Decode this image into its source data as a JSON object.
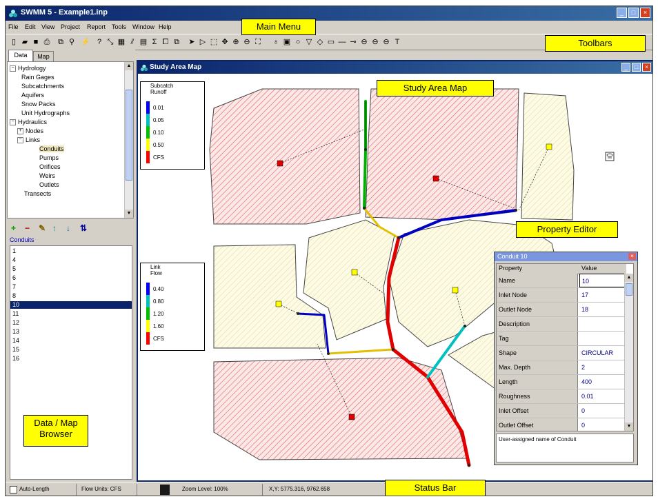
{
  "app": {
    "title": "SWMM 5 - Example1.inp",
    "controls": [
      "_",
      "□",
      "×"
    ]
  },
  "menu": [
    "File",
    "Edit",
    "View",
    "Project",
    "Report",
    "Tools",
    "Window",
    "Help"
  ],
  "callouts": {
    "main_menu": "Main Menu",
    "toolbars": "Toolbars",
    "study_area_map": "Study Area Map",
    "property_editor": "Property Editor",
    "browser_line1": "Data / Map",
    "browser_line2": "Browser",
    "status_bar": "Status Bar"
  },
  "browser": {
    "tabs": [
      "Data",
      "Map"
    ],
    "tree": [
      {
        "label": "Hydrology",
        "level": 0,
        "box": "−"
      },
      {
        "label": "Rain Gages",
        "level": 2
      },
      {
        "label": "Subcatchments",
        "level": 2
      },
      {
        "label": "Aquifers",
        "level": 2
      },
      {
        "label": "Snow Packs",
        "level": 2
      },
      {
        "label": "Unit Hydrographs",
        "level": 2
      },
      {
        "label": "Hydraulics",
        "level": 0,
        "box": "−"
      },
      {
        "label": "Nodes",
        "level": 1,
        "box": "+"
      },
      {
        "label": "Links",
        "level": 1,
        "box": "−"
      },
      {
        "label": "Conduits",
        "level": 3
      },
      {
        "label": "Pumps",
        "level": 3
      },
      {
        "label": "Orifices",
        "level": 3
      },
      {
        "label": "Weirs",
        "level": 3
      },
      {
        "label": "Outlets",
        "level": 3
      },
      {
        "label": "Transects",
        "level": 1
      }
    ],
    "list_label": "Conduits",
    "items": [
      "1",
      "4",
      "5",
      "6",
      "7",
      "8",
      "10",
      "11",
      "12",
      "13",
      "14",
      "15",
      "16"
    ],
    "selected_item": "10"
  },
  "map_window": {
    "title": "Study Area Map",
    "subcatchment_legend": {
      "title_line1": "Subcatch",
      "title_line2": "Runoff",
      "values": [
        "0.01",
        "0.05",
        "0.10",
        "0.50",
        "CFS"
      ],
      "colors": [
        "#0000ff",
        "#00c0c0",
        "#00c000",
        "#ffff00",
        "#ff0000"
      ]
    },
    "link_legend": {
      "title_line1": "Link",
      "title_line2": "Flow",
      "values": [
        "0.40",
        "0.80",
        "1.20",
        "1.60",
        "CFS"
      ],
      "colors": [
        "#0000ff",
        "#00c0c0",
        "#00c000",
        "#ffff00",
        "#ff0000"
      ]
    }
  },
  "property_editor": {
    "title": "Conduit 10",
    "col_property": "Property",
    "col_value": "Value",
    "rows": [
      {
        "name": "Name",
        "value": "10"
      },
      {
        "name": "Inlet Node",
        "value": "17"
      },
      {
        "name": "Outlet Node",
        "value": "18"
      },
      {
        "name": "Description",
        "value": ""
      },
      {
        "name": "Tag",
        "value": ""
      },
      {
        "name": "Shape",
        "value": "CIRCULAR"
      },
      {
        "name": "Max. Depth",
        "value": "2"
      },
      {
        "name": "Length",
        "value": "400"
      },
      {
        "name": "Roughness",
        "value": "0.01"
      },
      {
        "name": "Inlet Offset",
        "value": "0"
      },
      {
        "name": "Outlet Offset",
        "value": "0"
      }
    ],
    "description": "User-assigned name of Conduit"
  },
  "status": {
    "auto_length": "Auto-Length",
    "flow_units": "Flow Units: CFS",
    "zoom": "Zoom Level: 100%",
    "xy": "X,Y: 5775.316, 9762.658"
  }
}
